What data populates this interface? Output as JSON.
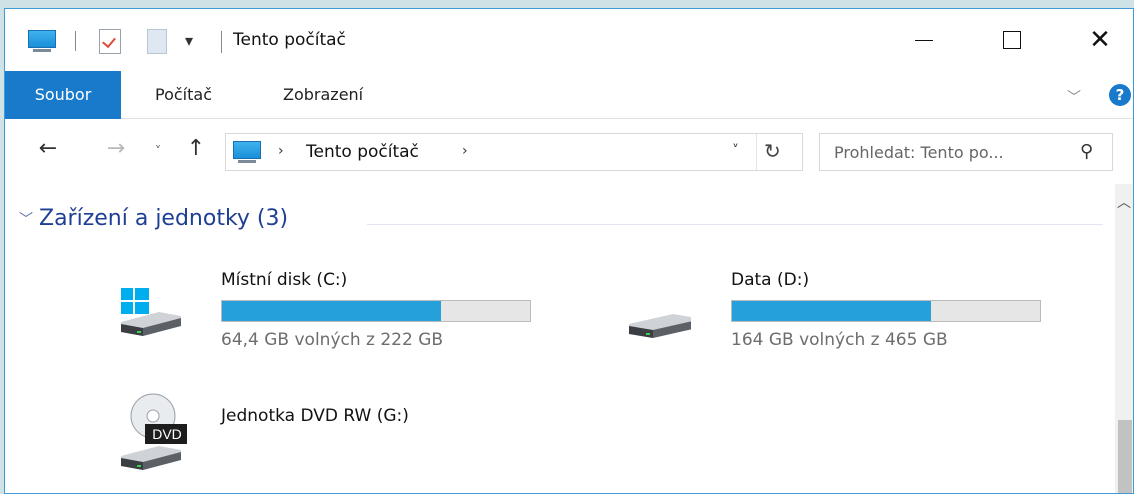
{
  "window": {
    "title": "Tento počítač",
    "qat_dropdown": "▾"
  },
  "ribbon": {
    "tabs": [
      "Soubor",
      "Počítač",
      "Zobrazení"
    ],
    "help": "?"
  },
  "navigation": {
    "back": "←",
    "forward": "→",
    "recent": "˅",
    "up": "↑",
    "address": "Tento počítač",
    "refresh": "↻",
    "search_placeholder": "Prohledat: Tento po..."
  },
  "group": {
    "title": "Zařízení a jednotky (3)"
  },
  "drives": [
    {
      "name": "Místní disk (C:)",
      "space": "64,4 GB volných z 222 GB",
      "used_fraction": 0.71,
      "icon": "windows-hdd-icon"
    },
    {
      "name": "Data (D:)",
      "space": "164 GB volných z 465 GB",
      "used_fraction": 0.647,
      "icon": "hdd-icon"
    },
    {
      "name": "Jednotka DVD RW (G:)",
      "icon": "dvd-drive-icon",
      "badge": "DVD"
    }
  ],
  "colors": {
    "accent": "#1979ca",
    "bar_fill": "#26a0da",
    "group_title": "#1e3f95"
  }
}
